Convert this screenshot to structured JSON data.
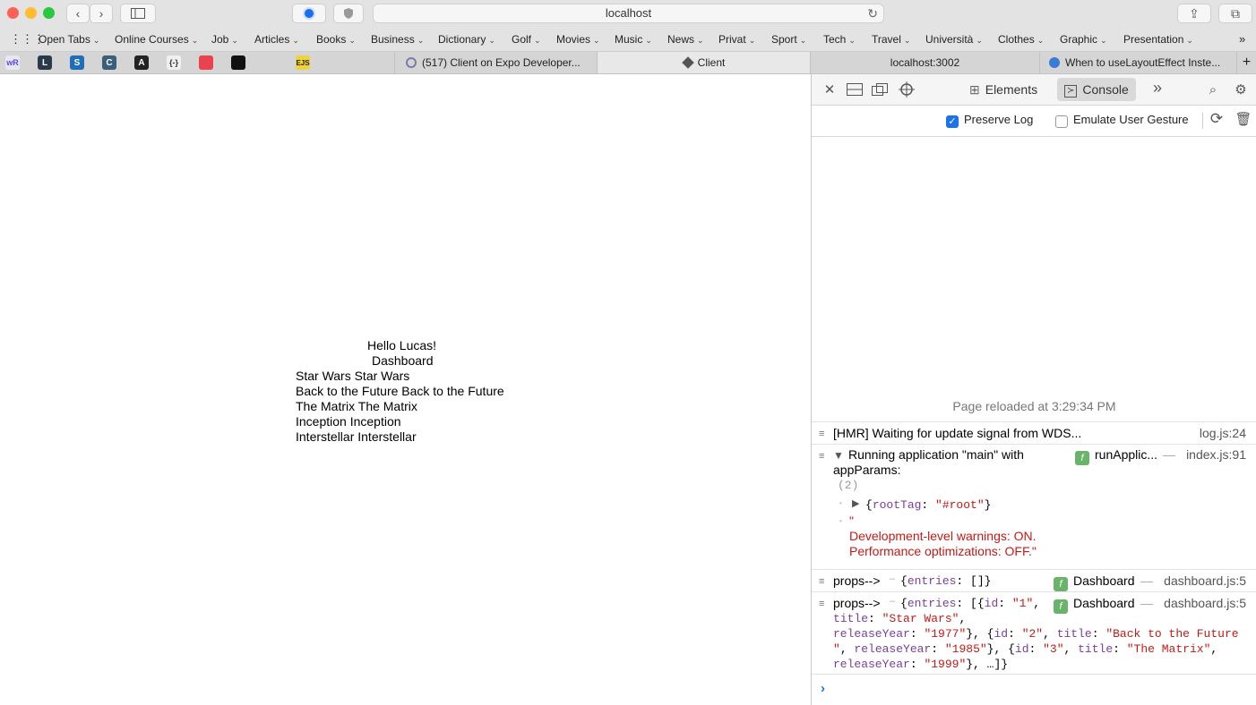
{
  "browser": {
    "url": "localhost",
    "bookmarks": [
      "Open Tabs",
      "Online Courses",
      "Job",
      "Articles",
      "Books",
      "Business",
      "Dictionary",
      "Golf",
      "Movies",
      "Music",
      "News",
      "Privat",
      "Sport",
      "Tech",
      "Travel",
      "Università",
      "Clothes",
      "Graphic",
      "Presentation"
    ],
    "pinned": [
      "wR",
      "L",
      "S",
      "C",
      "A",
      "{-}",
      "",
      "",
      "",
      "EJS",
      "",
      ""
    ],
    "tabs": [
      "(517) Client on Expo Developer...",
      "Client",
      "localhost:3002",
      "When to useLayoutEffect Inste..."
    ]
  },
  "page": {
    "greeting": "Hello Lucas!",
    "title": "Dashboard",
    "movies": [
      "Star Wars Star Wars",
      "Back to the Future Back to the Future",
      "The Matrix The Matrix",
      "Inception Inception",
      "Interstellar Interstellar"
    ]
  },
  "devtools": {
    "tabs": {
      "elements": "Elements",
      "console": "Console"
    },
    "options": {
      "preserve_log": "Preserve Log",
      "emulate_gesture": "Emulate User Gesture"
    },
    "reloaded": "Page reloaded at 3:29:34 PM",
    "logs": {
      "hmr": {
        "text": "[HMR] Waiting for update signal from WDS...",
        "source": "log.js:24"
      },
      "running": {
        "line1": "Running application \"main\" with",
        "line2": "appParams:",
        "fn": "runApplic...",
        "source": "index.js:91",
        "count": "(2)",
        "roottag_open": "{",
        "roottag_key": "rootTag",
        "roottag_colon": ": ",
        "roottag_value": "\"#root\"",
        "roottag_close": "}",
        "quote": "\"",
        "warn1": "Development-level warnings: ON.",
        "warn2": "Performance optimizations: OFF.\""
      },
      "props1": {
        "label": "props-->",
        "body_open": "{",
        "body_key": "entries",
        "body_rest": ": []}",
        "fn": "Dashboard",
        "source": "dashboard.js:5"
      },
      "props2": {
        "label": "props-->",
        "fn": "Dashboard",
        "source": "dashboard.js:5",
        "l1a": "{",
        "l1k1": "entries",
        "l1b": ": [{",
        "l1k2": "id",
        "l1c": ": ",
        "l1v1": "\"1\"",
        "l1d": ",",
        "l2k": "title",
        "l2a": ": ",
        "l2v": "\"Star Wars\"",
        "l2b": ",",
        "l3k": "releaseYear",
        "l3a": ": ",
        "l3v": "\"1977\"",
        "l3b": "}, {",
        "l3k2": "id",
        "l3c": ": ",
        "l3v2": "\"2\"",
        "l3d": ", ",
        "l3k3": "title",
        "l3e": ": ",
        "l3v3": "\"Back to the Future",
        "l4v": "\"",
        "l4a": ", ",
        "l4k": "releaseYear",
        "l4b": ": ",
        "l4v2": "\"1985\"",
        "l4c": "}, {",
        "l4k2": "id",
        "l4d": ": ",
        "l4v3": "\"3\"",
        "l4e": ", ",
        "l4k3": "title",
        "l4f": ": ",
        "l4v4": "\"The Matrix\"",
        "l4g": ",",
        "l5k": "releaseYear",
        "l5a": ": ",
        "l5v": "\"1999\"",
        "l5b": "}, …]}"
      }
    }
  }
}
